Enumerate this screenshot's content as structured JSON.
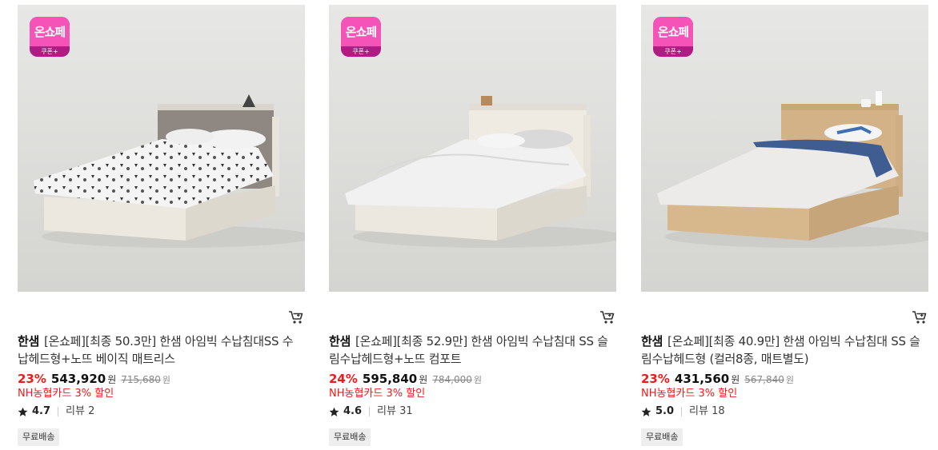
{
  "colors": {
    "discount": "#f01a1a",
    "badge": "#e62a9c",
    "text": "#222222",
    "muted": "#888888"
  },
  "products": [
    {
      "badge": {
        "label": "온쇼페",
        "sub": "쿠폰+"
      },
      "cart_icon": "cart-icon",
      "brand": "한샘",
      "title": "[온쇼페][최종 50.3만] 한샘 아임빅 수납침대SS 수납헤드형+노뜨 베이직 매트리스",
      "discount": "23%",
      "price": "543,920",
      "price_unit": "원",
      "original_price": "715,680",
      "original_unit": "원",
      "promo": "NH농협카드 3% 할인",
      "rating": "4.7",
      "reviews": "리뷰 2",
      "shipping": "무료배송",
      "frame": "#ece8df",
      "headboard": "#8f8782",
      "bedding": "pattern"
    },
    {
      "badge": {
        "label": "온쇼페",
        "sub": "쿠폰+"
      },
      "cart_icon": "cart-icon",
      "brand": "한샘",
      "title": "[온쇼페][최종 52.9만] 한샘 아임빅 수납침대 SS 슬림수납헤드형+노뜨 컴포트",
      "discount": "24%",
      "price": "595,840",
      "price_unit": "원",
      "original_price": "784,000",
      "original_unit": "원",
      "promo": "NH농협카드 3% 할인",
      "rating": "4.6",
      "reviews": "리뷰 31",
      "shipping": "무료배송",
      "frame": "#ece8df",
      "headboard": "#efebe3",
      "bedding": "light"
    },
    {
      "badge": {
        "label": "온쇼페",
        "sub": "쿠폰+"
      },
      "cart_icon": "cart-icon",
      "brand": "한샘",
      "title": "[온쇼페][최종 40.9만] 한샘 아임빅 수납침대 SS 슬림수납헤드형 (컬러8종, 매트별도)",
      "discount": "23%",
      "price": "431,560",
      "price_unit": "원",
      "original_price": "567,840",
      "original_unit": "원",
      "promo": "NH농협카드 3% 할인",
      "rating": "5.0",
      "reviews": "리뷰 18",
      "shipping": "무료배송",
      "frame": "#d7b88c",
      "headboard": "#d3b287",
      "bedding": "blue"
    }
  ]
}
